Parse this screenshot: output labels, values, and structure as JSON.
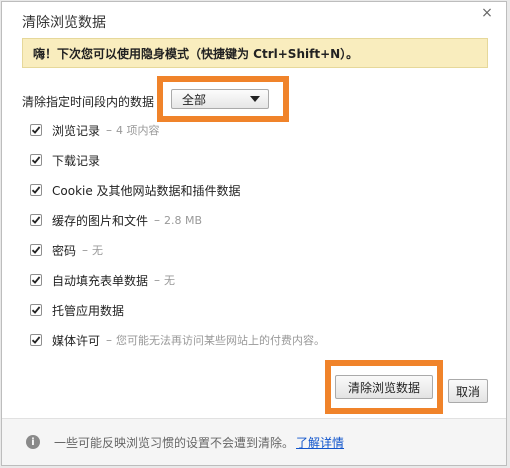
{
  "dialog": {
    "title": "清除浏览数据",
    "close_label": "×"
  },
  "banner": {
    "text": "嗨！下次您可以使用隐身模式（快捷键为 Ctrl+Shift+N）。"
  },
  "time_range": {
    "label": "清除指定时间段内的数据",
    "selected": "全部"
  },
  "items": [
    {
      "label": "浏览记录",
      "checked": true,
      "detail": "4 项内容"
    },
    {
      "label": "下载记录",
      "checked": true,
      "detail": ""
    },
    {
      "label": "Cookie 及其他网站数据和插件数据",
      "checked": true,
      "detail": ""
    },
    {
      "label": "缓存的图片和文件",
      "checked": true,
      "detail": "2.8 MB"
    },
    {
      "label": "密码",
      "checked": true,
      "detail": "无"
    },
    {
      "label": "自动填充表单数据",
      "checked": true,
      "detail": "无"
    },
    {
      "label": "托管应用数据",
      "checked": true,
      "detail": ""
    },
    {
      "label": "媒体许可",
      "checked": true,
      "detail": "您可能无法再访问某些网站上的付费内容。"
    }
  ],
  "buttons": {
    "clear": "清除浏览数据",
    "cancel": "取消"
  },
  "footer": {
    "info_glyph": "i",
    "text": "一些可能反映浏览习惯的设置不会遭到清除。",
    "link": "了解详情"
  },
  "colors": {
    "highlight": "#f0832a",
    "banner_bg": "#f9edbe",
    "link": "#1155cc"
  }
}
